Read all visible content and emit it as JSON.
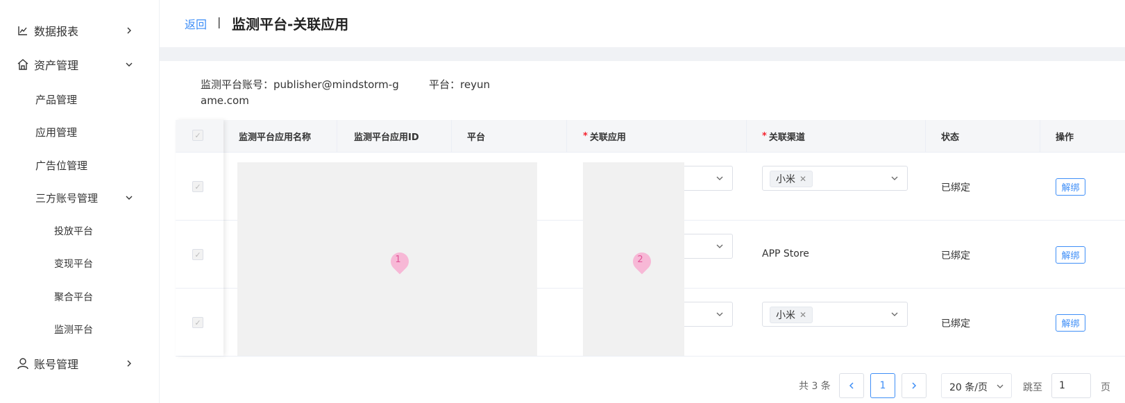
{
  "sidebar": {
    "items": [
      {
        "label": "数据报表",
        "icon": "chart-line-icon"
      },
      {
        "label": "资产管理",
        "icon": "home-icon"
      },
      {
        "label": "产品管理"
      },
      {
        "label": "应用管理"
      },
      {
        "label": "广告位管理"
      },
      {
        "label": "三方账号管理"
      },
      {
        "label": "投放平台"
      },
      {
        "label": "变现平台"
      },
      {
        "label": "聚合平台"
      },
      {
        "label": "监测平台"
      },
      {
        "label": "账号管理",
        "icon": "user-icon"
      }
    ]
  },
  "header": {
    "back": "返回",
    "separator": "|",
    "title": "监测平台-关联应用"
  },
  "info": {
    "account": "监测平台账号：publisher@mindstorm-game.com",
    "platform": "平台：reyun"
  },
  "table": {
    "columns": [
      "监测平台应用名称",
      "监测平台应用ID",
      "平台",
      "关联应用",
      "关联渠道",
      "状态",
      "操作"
    ],
    "required_mark": "*",
    "rows": [
      {
        "channel_tag": "小米",
        "channel_text": "",
        "status": "已绑定",
        "action": "解绑"
      },
      {
        "channel_tag": "",
        "channel_text": "APP Store",
        "status": "已绑定",
        "action": "解绑"
      },
      {
        "channel_tag": "小米",
        "channel_text": "",
        "status": "已绑定",
        "action": "解绑"
      }
    ]
  },
  "markers": [
    "1",
    "2"
  ],
  "pagination": {
    "total": "共 3 条",
    "current_page": "1",
    "page_size": "20 条/页",
    "jump_label": "跳至",
    "jump_value": "1",
    "page_label": "页"
  },
  "colors": {
    "accent": "#3e8ef7",
    "required": "#f5222d",
    "marker": "#f7b8d6"
  }
}
